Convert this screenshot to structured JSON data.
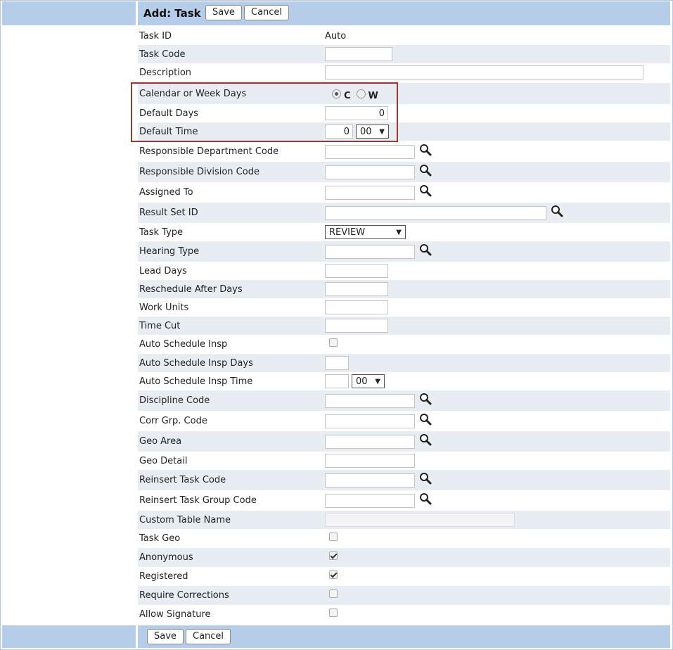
{
  "header": {
    "title": "Add: Task",
    "save_label": "Save",
    "cancel_label": "Cancel"
  },
  "footer": {
    "save_label": "Save",
    "cancel_label": "Cancel"
  },
  "form": {
    "task_id": {
      "label": "Task ID",
      "value": "Auto"
    },
    "task_code": {
      "label": "Task Code",
      "value": ""
    },
    "description": {
      "label": "Description",
      "value": ""
    },
    "calendar_or_week_days": {
      "label": "Calendar or Week Days",
      "option_c": "C",
      "option_w": "W",
      "selected": "C"
    },
    "default_days": {
      "label": "Default Days",
      "value": "0"
    },
    "default_time": {
      "label": "Default Time",
      "hour": "0",
      "minute": "00"
    },
    "responsible_department_code": {
      "label": "Responsible Department Code",
      "value": ""
    },
    "responsible_division_code": {
      "label": "Responsible Division Code",
      "value": ""
    },
    "assigned_to": {
      "label": "Assigned To",
      "value": ""
    },
    "result_set_id": {
      "label": "Result Set ID",
      "value": ""
    },
    "task_type": {
      "label": "Task Type",
      "value": "REVIEW"
    },
    "hearing_type": {
      "label": "Hearing Type",
      "value": ""
    },
    "lead_days": {
      "label": "Lead Days",
      "value": ""
    },
    "reschedule_after_days": {
      "label": "Reschedule After Days",
      "value": ""
    },
    "work_units": {
      "label": "Work Units",
      "value": ""
    },
    "time_cut": {
      "label": "Time Cut",
      "value": ""
    },
    "auto_schedule_insp": {
      "label": "Auto Schedule Insp",
      "checked": false
    },
    "auto_schedule_insp_days": {
      "label": "Auto Schedule Insp Days",
      "value": ""
    },
    "auto_schedule_insp_time": {
      "label": "Auto Schedule Insp Time",
      "hour": "",
      "minute": "00"
    },
    "discipline_code": {
      "label": "Discipline Code",
      "value": ""
    },
    "corr_grp_code": {
      "label": "Corr Grp. Code",
      "value": ""
    },
    "geo_area": {
      "label": "Geo Area",
      "value": ""
    },
    "geo_detail": {
      "label": "Geo Detail",
      "value": ""
    },
    "reinsert_task_code": {
      "label": "Reinsert Task Code",
      "value": ""
    },
    "reinsert_task_group_code": {
      "label": "Reinsert Task Group Code",
      "value": ""
    },
    "custom_table_name": {
      "label": "Custom Table Name",
      "value": ""
    },
    "task_geo": {
      "label": "Task Geo",
      "checked": false
    },
    "anonymous": {
      "label": "Anonymous",
      "checked": true
    },
    "registered": {
      "label": "Registered",
      "checked": true
    },
    "require_corrections": {
      "label": "Require Corrections",
      "checked": false
    },
    "allow_signature": {
      "label": "Allow Signature",
      "checked": false
    }
  },
  "icons": {
    "lookup": "magnifier-icon",
    "dropdown": "triangle-down-icon"
  },
  "colors": {
    "header_bar": "#b5cde8",
    "row_shade": "#e8edf4",
    "highlight_border": "#b52a2a"
  }
}
